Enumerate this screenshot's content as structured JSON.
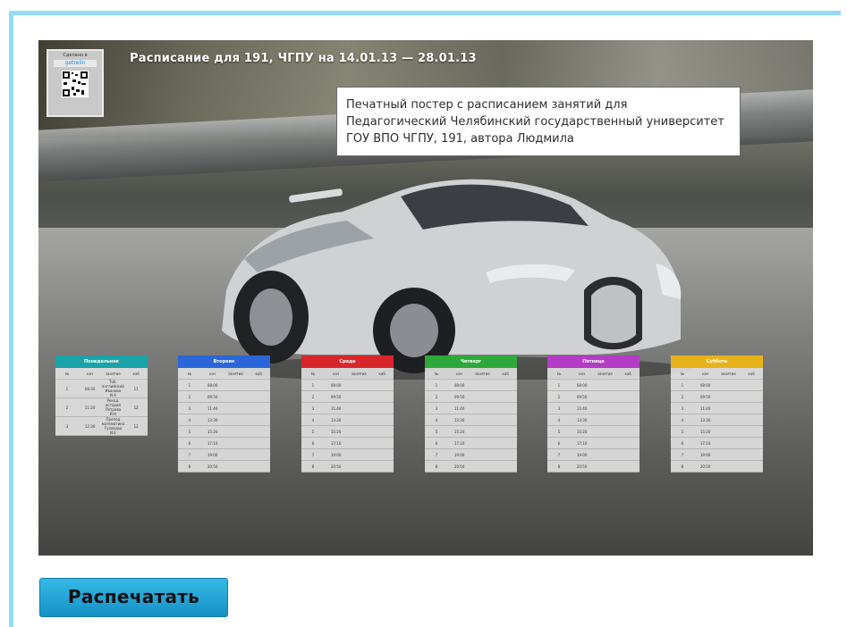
{
  "poster": {
    "title": "Расписание для 191, ЧГПУ на 14.01.13 — 28.01.13",
    "qr_label": "Сделано в",
    "qr_brand": "getreiin",
    "description": "Печатный постер с расписанием занятий для Педагогический Челябинский государственный университет ГОУ ВПО ЧГПУ, 191, автора Людмила"
  },
  "schedule": {
    "columns": [
      "№",
      "нач",
      "занятие",
      "каб"
    ],
    "days": [
      {
        "name": "Понедельник",
        "color": "#1aa3a8",
        "rows": [
          [
            "1",
            "08:30",
            "Тоб. английский Иванова И.А",
            "11"
          ],
          [
            "2",
            "11:20",
            "Рекод. история Петрова И.Н",
            "12"
          ],
          [
            "3",
            "12:30",
            "Препод математика Гулякова И.Е",
            "12"
          ]
        ]
      },
      {
        "name": "Вторник",
        "color": "#2a66d8",
        "rows": [
          [
            "1",
            "08:00",
            "",
            ""
          ],
          [
            "2",
            "09:50",
            "",
            ""
          ],
          [
            "3",
            "11:40",
            "",
            ""
          ],
          [
            "4",
            "13:30",
            "",
            ""
          ],
          [
            "5",
            "15:20",
            "",
            ""
          ],
          [
            "6",
            "17:10",
            "",
            ""
          ],
          [
            "7",
            "19:00",
            "",
            ""
          ],
          [
            "8",
            "20:50",
            "",
            ""
          ]
        ]
      },
      {
        "name": "Среда",
        "color": "#d9262b",
        "rows": [
          [
            "1",
            "08:00",
            "",
            ""
          ],
          [
            "2",
            "09:50",
            "",
            ""
          ],
          [
            "3",
            "11:40",
            "",
            ""
          ],
          [
            "4",
            "13:30",
            "",
            ""
          ],
          [
            "5",
            "15:20",
            "",
            ""
          ],
          [
            "6",
            "17:10",
            "",
            ""
          ],
          [
            "7",
            "19:00",
            "",
            ""
          ],
          [
            "8",
            "20:50",
            "",
            ""
          ]
        ]
      },
      {
        "name": "Четверг",
        "color": "#2ea83a",
        "rows": [
          [
            "1",
            "08:00",
            "",
            ""
          ],
          [
            "2",
            "09:50",
            "",
            ""
          ],
          [
            "3",
            "11:40",
            "",
            ""
          ],
          [
            "4",
            "13:30",
            "",
            ""
          ],
          [
            "5",
            "15:20",
            "",
            ""
          ],
          [
            "6",
            "17:10",
            "",
            ""
          ],
          [
            "7",
            "19:00",
            "",
            ""
          ],
          [
            "8",
            "20:50",
            "",
            ""
          ]
        ]
      },
      {
        "name": "Пятница",
        "color": "#b23cc4",
        "rows": [
          [
            "1",
            "08:00",
            "",
            ""
          ],
          [
            "2",
            "09:50",
            "",
            ""
          ],
          [
            "3",
            "11:40",
            "",
            ""
          ],
          [
            "4",
            "13:30",
            "",
            ""
          ],
          [
            "5",
            "15:20",
            "",
            ""
          ],
          [
            "6",
            "17:10",
            "",
            ""
          ],
          [
            "7",
            "19:00",
            "",
            ""
          ],
          [
            "8",
            "20:50",
            "",
            ""
          ]
        ]
      },
      {
        "name": "Суббота",
        "color": "#e8b21a",
        "rows": [
          [
            "1",
            "08:00",
            "",
            ""
          ],
          [
            "2",
            "09:50",
            "",
            ""
          ],
          [
            "3",
            "11:40",
            "",
            ""
          ],
          [
            "4",
            "13:30",
            "",
            ""
          ],
          [
            "5",
            "15:20",
            "",
            ""
          ],
          [
            "6",
            "17:10",
            "",
            ""
          ],
          [
            "7",
            "19:00",
            "",
            ""
          ],
          [
            "8",
            "20:50",
            "",
            ""
          ]
        ]
      }
    ]
  },
  "actions": {
    "print_label": "Распечатать"
  }
}
